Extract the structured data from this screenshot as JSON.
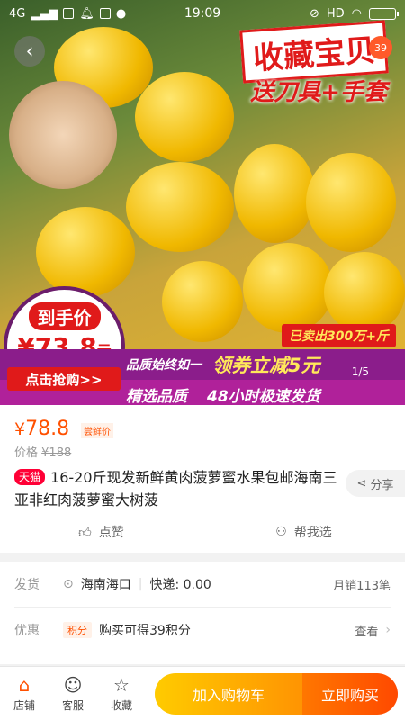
{
  "status_bar": {
    "network": "4G",
    "time": "19:09",
    "right_label": "HD"
  },
  "hero": {
    "fav_banner": "收藏宝贝",
    "gift_banner": "送刀具+手套",
    "image_count": "39",
    "sold_tag": "已卖出300万+斤",
    "price_circle_title": "到手价",
    "price_circle_value": "¥73.8",
    "price_circle_unit": "元",
    "grab_button": "点击抢购>>",
    "quality_slogan": "品质始终如一",
    "coupon_slogan": "领券立减5元",
    "select_slogan": "精选品质",
    "shipping_slogan": "48小时极速发货",
    "pager": "1/5"
  },
  "product": {
    "price_symbol": "¥",
    "price": "78.8",
    "price_badge": "尝鲜价",
    "original_price_label": "价格",
    "original_price": "¥188",
    "shop_tag": "天猫",
    "title": "16-20斤现发新鲜黄肉菠萝蜜水果包邮海南三亚非红肉菠萝蜜大树菠",
    "share_label": "分享",
    "like_label": "点赞",
    "help_label": "帮我选"
  },
  "info": {
    "ship_label": "发货",
    "ship_location": "海南海口",
    "express": "快递: 0.00",
    "monthly_sales": "月销113笔",
    "promo_label": "优惠",
    "points_tag": "积分",
    "points_text": "购买可得39积分",
    "view_label": "查看"
  },
  "bottom_bar": {
    "shop": "店铺",
    "service": "客服",
    "favorite": "收藏",
    "add_to_cart": "加入购物车",
    "buy_now": "立即购买"
  },
  "colors": {
    "accent": "#ff5000",
    "tmall": "#ff0036",
    "cart_gradient_start": "#ffcb00",
    "buy_gradient_end": "#ff4900"
  }
}
